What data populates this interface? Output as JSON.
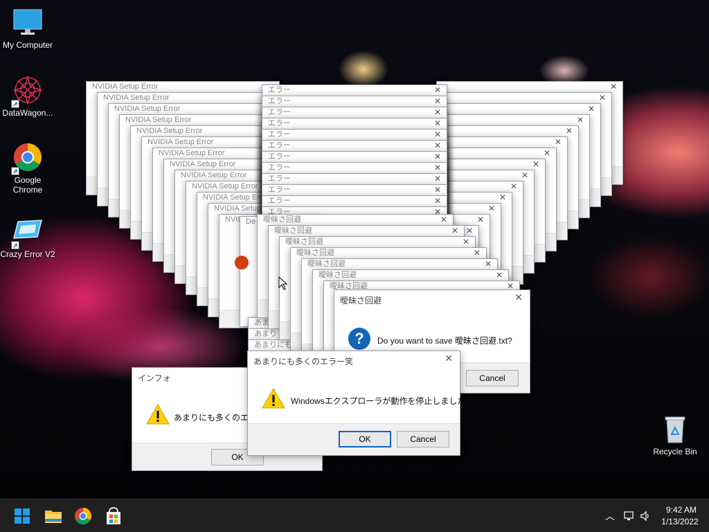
{
  "desktop": {
    "icons": [
      {
        "label": "My Computer",
        "icon": "monitor-icon"
      },
      {
        "label": "DataWagon...",
        "icon": "mandala-icon"
      },
      {
        "label": "Google Chrome",
        "icon": "chrome-icon"
      },
      {
        "label": "Crazy Error V2",
        "icon": "error-app-icon"
      },
      {
        "label": "Recycle Bin",
        "icon": "recycle-bin-icon"
      }
    ]
  },
  "stacks": {
    "nvidia_title": "NVIDIA Setup Error",
    "error_title": "エラー",
    "aimai_title": "曖昧さ回避",
    "amari_title": "あまりにも多くのエラー笑",
    "de_title": "De",
    "nvidia_partial": "NVIDI",
    "nvidia_count": 13,
    "error_count": 12,
    "right_count": 14,
    "aimai_count": 7
  },
  "dialogs": {
    "info": {
      "title": "インフォ",
      "message": "あまりにも多くのエラー笑",
      "ok": "OK"
    },
    "save": {
      "title": "曖昧さ回避",
      "message": "Do you want to save 曖昧さ回避.txt?",
      "cancel": "Cancel"
    },
    "explorer": {
      "title": "あまりにも多くのエラー笑",
      "message": "Windowsエクスプローラが動作を停止しました",
      "ok": "OK",
      "cancel": "Cancel"
    }
  },
  "left_labels": [
    "あま",
    "あまり",
    "あまりにも"
  ],
  "taskbar": {
    "apps": [
      "start-icon",
      "file-explorer-icon",
      "chrome-icon",
      "store-icon"
    ],
    "time": "9:42 AM",
    "date": "1/13/2022"
  },
  "colors": {
    "accent": "#0a64d0",
    "taskbar": "#202020",
    "warn": "#ffd200"
  }
}
